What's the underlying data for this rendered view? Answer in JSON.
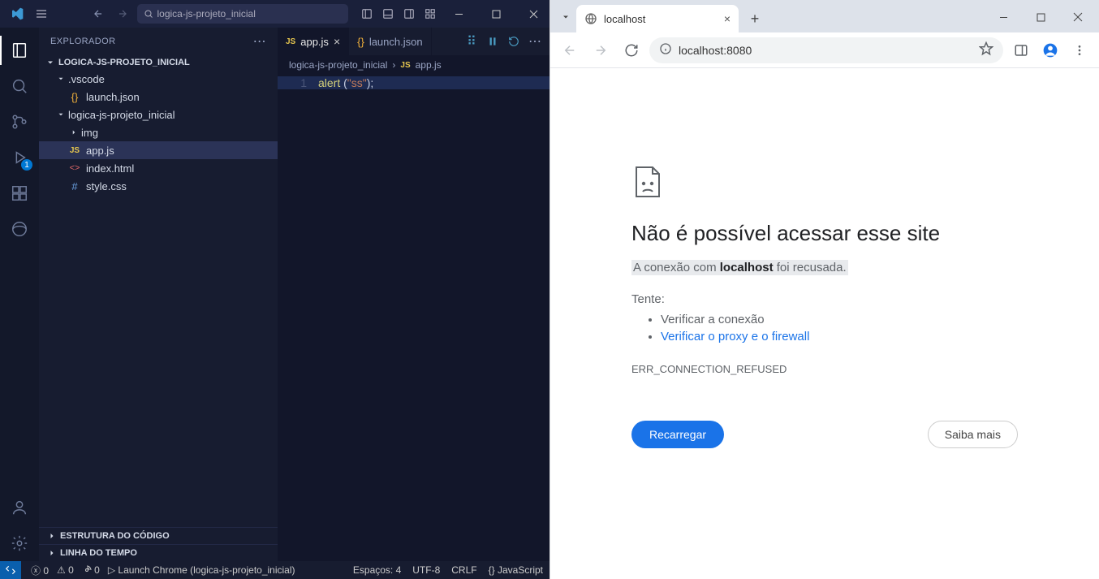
{
  "vscode": {
    "search_placeholder": "logica-js-projeto_inicial",
    "explorer_label": "EXPLORADOR",
    "project_title": "LOGICA-JS-PROJETO_INICIAL",
    "debug_badge": "1",
    "tree": {
      "vscode_folder": ".vscode",
      "launch_json": "launch.json",
      "project_folder": "logica-js-projeto_inicial",
      "img_folder": "img",
      "app_js": "app.js",
      "index_html": "index.html",
      "style_css": "style.css"
    },
    "outline_label": "ESTRUTURA DO CÓDIGO",
    "timeline_label": "LINHA DO TEMPO",
    "tabs": [
      {
        "label": "app.js",
        "active": true,
        "icon": "js"
      },
      {
        "label": "launch.json",
        "active": false,
        "icon": "json"
      }
    ],
    "breadcrumb": {
      "root": "logica-js-projeto_inicial",
      "file": "app.js"
    },
    "code": {
      "line_no": "1",
      "fn": "alert",
      "open": " (",
      "str": "\"ss\"",
      "close": ")",
      "semi": ";"
    },
    "status": {
      "errors": "0",
      "warnings": "0",
      "port": "0",
      "launch_label": "Launch Chrome (logica-js-projeto_inicial)",
      "spaces": "Espaços: 4",
      "encoding": "UTF-8",
      "eol": "CRLF",
      "lang": "JavaScript"
    }
  },
  "chrome": {
    "tab_title": "localhost",
    "address": "localhost:8080",
    "error": {
      "title": "Não é possível acessar esse site",
      "prefix": "A conexão com ",
      "host": "localhost",
      "suffix": " foi recusada.",
      "try_label": "Tente:",
      "check_connection": "Verificar a conexão",
      "check_proxy": "Verificar o proxy e o firewall",
      "code": "ERR_CONNECTION_REFUSED",
      "reload_btn": "Recarregar",
      "more_btn": "Saiba mais"
    }
  }
}
